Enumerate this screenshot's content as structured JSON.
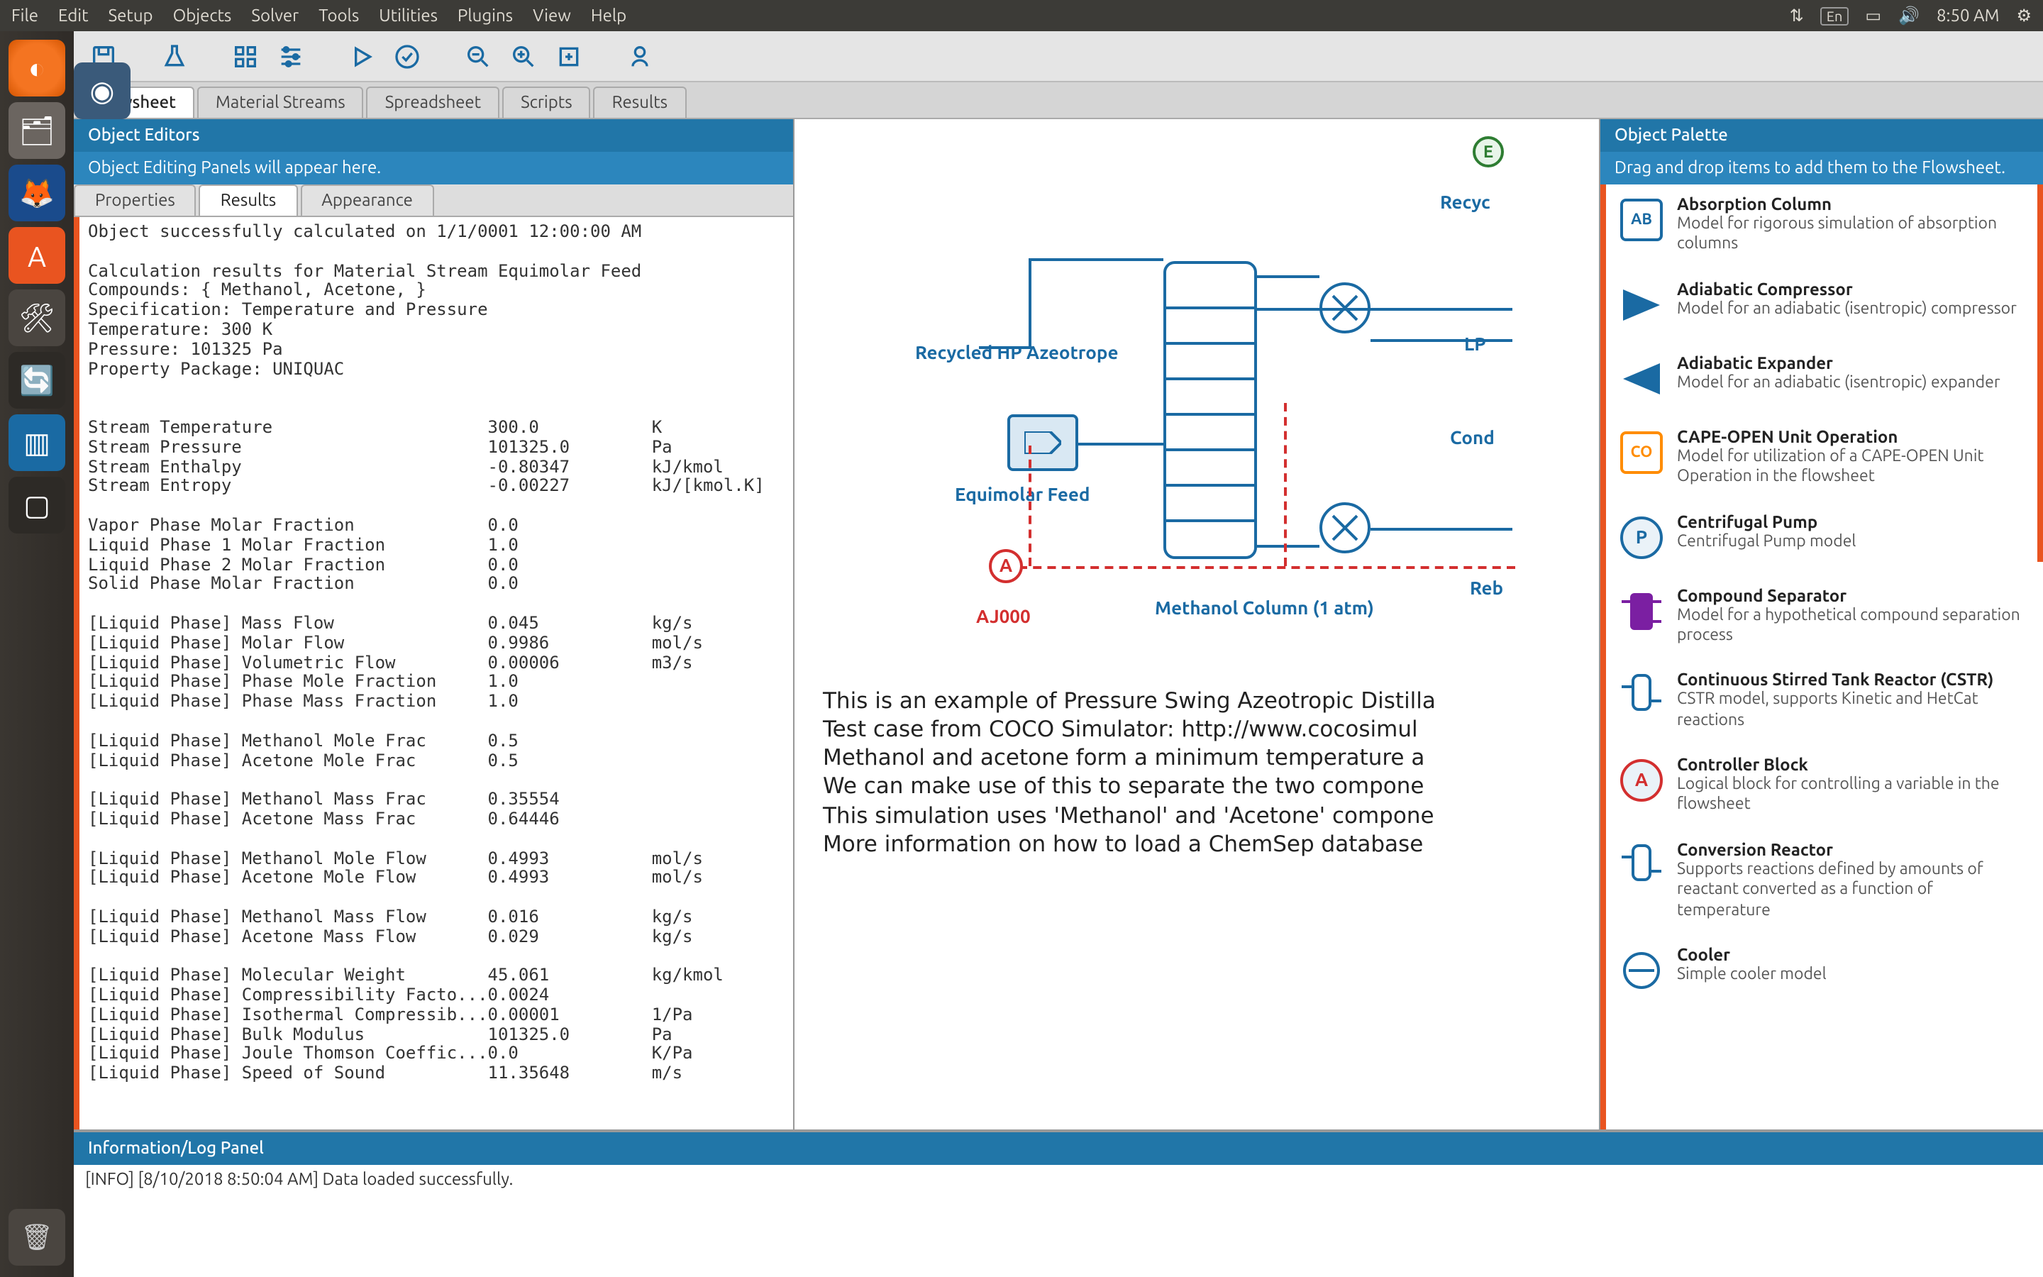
{
  "system": {
    "menus": [
      "File",
      "Edit",
      "Setup",
      "Objects",
      "Solver",
      "Tools",
      "Utilities",
      "Plugins",
      "View",
      "Help"
    ],
    "indicators": {
      "lang": "En",
      "time": "8:50 AM"
    }
  },
  "doc_tabs": [
    "Flowsheet",
    "Material Streams",
    "Spreadsheet",
    "Scripts",
    "Results"
  ],
  "doc_tab_active": 0,
  "left_panel": {
    "title": "Object Editors",
    "subtitle": "Object Editing Panels will appear here.",
    "subtabs": [
      "Properties",
      "Results",
      "Appearance"
    ],
    "subtab_active": 1,
    "results_text": "Object successfully calculated on 1/1/0001 12:00:00 AM\n\nCalculation results for Material Stream Equimolar Feed\nCompounds: { Methanol, Acetone, }\nSpecification: Temperature and Pressure\nTemperature: 300 K\nPressure: 101325 Pa\nProperty Package: UNIQUAC\n\n\nStream Temperature                     300.0           K\nStream Pressure                        101325.0        Pa\nStream Enthalpy                        -0.80347        kJ/kmol\nStream Entropy                         -0.00227        kJ/[kmol.K]\n\nVapor Phase Molar Fraction             0.0\nLiquid Phase 1 Molar Fraction          1.0\nLiquid Phase 2 Molar Fraction          0.0\nSolid Phase Molar Fraction             0.0\n\n[Liquid Phase] Mass Flow               0.045           kg/s\n[Liquid Phase] Molar Flow              0.9986          mol/s\n[Liquid Phase] Volumetric Flow         0.00006         m3/s\n[Liquid Phase] Phase Mole Fraction     1.0\n[Liquid Phase] Phase Mass Fraction     1.0\n\n[Liquid Phase] Methanol Mole Frac      0.5\n[Liquid Phase] Acetone Mole Frac       0.5\n\n[Liquid Phase] Methanol Mass Frac      0.35554\n[Liquid Phase] Acetone Mass Frac       0.64446\n\n[Liquid Phase] Methanol Mole Flow      0.4993          mol/s\n[Liquid Phase] Acetone Mole Flow       0.4993          mol/s\n\n[Liquid Phase] Methanol Mass Flow      0.016           kg/s\n[Liquid Phase] Acetone Mass Flow       0.029           kg/s\n\n[Liquid Phase] Molecular Weight        45.061          kg/kmol\n[Liquid Phase] Compressibility Facto...0.0024\n[Liquid Phase] Isothermal Compressib...0.00001         1/Pa\n[Liquid Phase] Bulk Modulus            101325.0        Pa\n[Liquid Phase] Joule Thomson Coeffic...0.0             K/Pa\n[Liquid Phase] Speed of Sound          11.35648        m/s"
  },
  "flowsheet": {
    "labels": {
      "recycled": "Recycled HP Azeotrope",
      "feed": "Equimolar Feed",
      "column": "Methanol Column (1 atm)",
      "recycle_top": "Recyc",
      "lp_side": "LP",
      "cond": "Cond",
      "reb": "Reb",
      "adjust": "AJ000",
      "adjust_letter": "A",
      "green_letter": "E"
    },
    "description_lines": [
      "This is an example of Pressure Swing Azeotropic Distilla",
      "Test case from COCO Simulator: http://www.cocosimul",
      "Methanol and acetone form a minimum temperature a",
      "We can make use of this to separate the two compone",
      "This simulation uses 'Methanol' and 'Acetone' compone",
      "More information on how to load a ChemSep database"
    ]
  },
  "palette": {
    "title": "Object Palette",
    "subtitle": "Drag and drop items to add them to the Flowsheet.",
    "items": [
      {
        "title": "Absorption Column",
        "desc": "Model for rigorous simulation of absorption columns",
        "color": "#1a6aa3",
        "label": "AB"
      },
      {
        "title": "Adiabatic Compressor",
        "desc": "Model for an adiabatic (isentropic) compressor",
        "color": "#1a6aa3",
        "shape": "tri-r"
      },
      {
        "title": "Adiabatic Expander",
        "desc": "Model for an adiabatic (isentropic) expander",
        "color": "#1a6aa3",
        "shape": "tri-l"
      },
      {
        "title": "CAPE-OPEN Unit Operation",
        "desc": "Model for utilization of a CAPE-OPEN Unit Operation in the flowsheet",
        "color": "#ff8c00",
        "label": "CO"
      },
      {
        "title": "Centrifugal Pump",
        "desc": "Centrifugal Pump model",
        "color": "#1a6aa3",
        "label": "P",
        "round": true
      },
      {
        "title": "Compound Separator",
        "desc": "Model for a hypothetical compound separation process",
        "color": "#7b1fa2",
        "shape": "block"
      },
      {
        "title": "Continuous Stirred Tank Reactor (CSTR)",
        "desc": "CSTR model, supports Kinetic and HetCat reactions",
        "color": "#1a6aa3",
        "shape": "vessel"
      },
      {
        "title": "Controller Block",
        "desc": "Logical block for controlling a variable in the flowsheet",
        "color": "#d32f2f",
        "label": "A",
        "round": true
      },
      {
        "title": "Conversion Reactor",
        "desc": "Supports reactions defined by amounts of reactant converted as a function of temperature",
        "color": "#1a6aa3",
        "shape": "vessel"
      },
      {
        "title": "Cooler",
        "desc": "Simple cooler model",
        "color": "#1a6aa3",
        "shape": "hex"
      }
    ]
  },
  "log": {
    "title": "Information/Log Panel",
    "line": "[INFO] [8/10/2018 8:50:04 AM] Data loaded successfully."
  }
}
